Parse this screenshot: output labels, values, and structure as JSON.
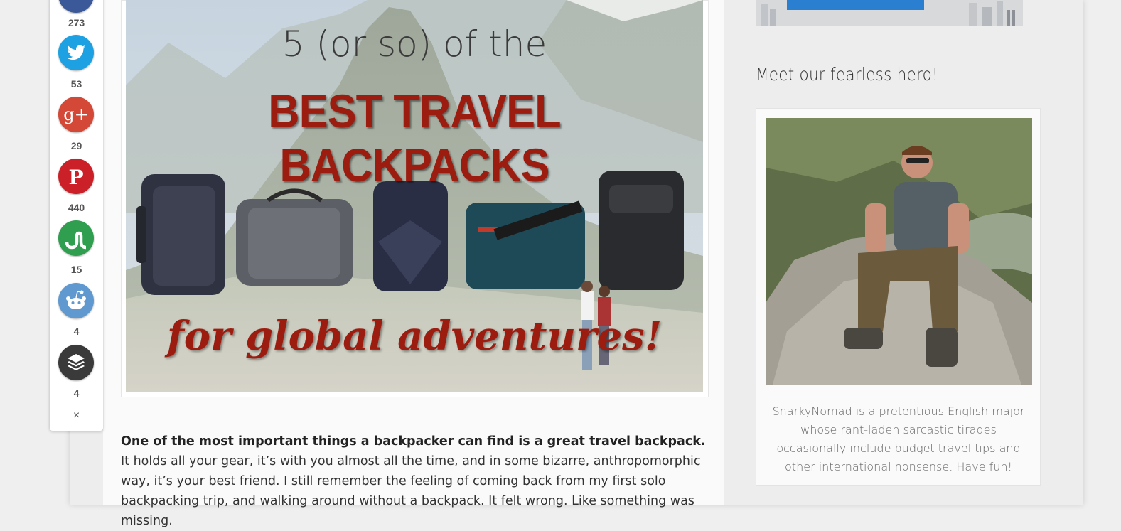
{
  "share_bar": {
    "counts": [
      "273",
      "53",
      "29",
      "440",
      "15",
      "4",
      "4"
    ],
    "close_label": "×",
    "buttons": [
      {
        "name": "facebook",
        "icon": "facebook-icon",
        "color": "#3b5998"
      },
      {
        "name": "twitter",
        "icon": "twitter-bird-icon",
        "color": "#1da1e2"
      },
      {
        "name": "google-plus",
        "icon": "google-plus-icon",
        "color": "#d34836",
        "glyph": "g+"
      },
      {
        "name": "pinterest",
        "icon": "pinterest-icon",
        "color": "#cb2027",
        "glyph": "P"
      },
      {
        "name": "stumbleupon",
        "icon": "stumbleupon-icon",
        "color": "#2f9e4f"
      },
      {
        "name": "reddit",
        "icon": "reddit-alien-icon",
        "color": "#5f99cf"
      },
      {
        "name": "buffer",
        "icon": "buffer-layers-icon",
        "color": "#3a3a3a"
      }
    ]
  },
  "hero": {
    "subtitle": "5 (or so) of the",
    "title": "BEST TRAVEL BACKPACKS",
    "tagline": "for global adventures!"
  },
  "article": {
    "lead_bold": "One of the most important things a backpacker can find is a great travel backpack.",
    "lead_rest": " It holds all your gear, it’s with you almost all the time, and in some bizarre, anthropomorphic way, it’s your best friend. I still remember the feeling of coming back from my first solo backpacking trip, and walking around without a backpack. It felt wrong. Like something was missing."
  },
  "sidebar": {
    "widget_title": "Meet our fearless hero!",
    "bio": "SnarkyNomad is a pretentious English major whose rant-laden sarcastic tirades occasionally include budget travel tips and other international nonsense. Have fun!"
  },
  "colors": {
    "accent_red": "#9c1c10",
    "ad_blue": "#2b7fd1"
  }
}
